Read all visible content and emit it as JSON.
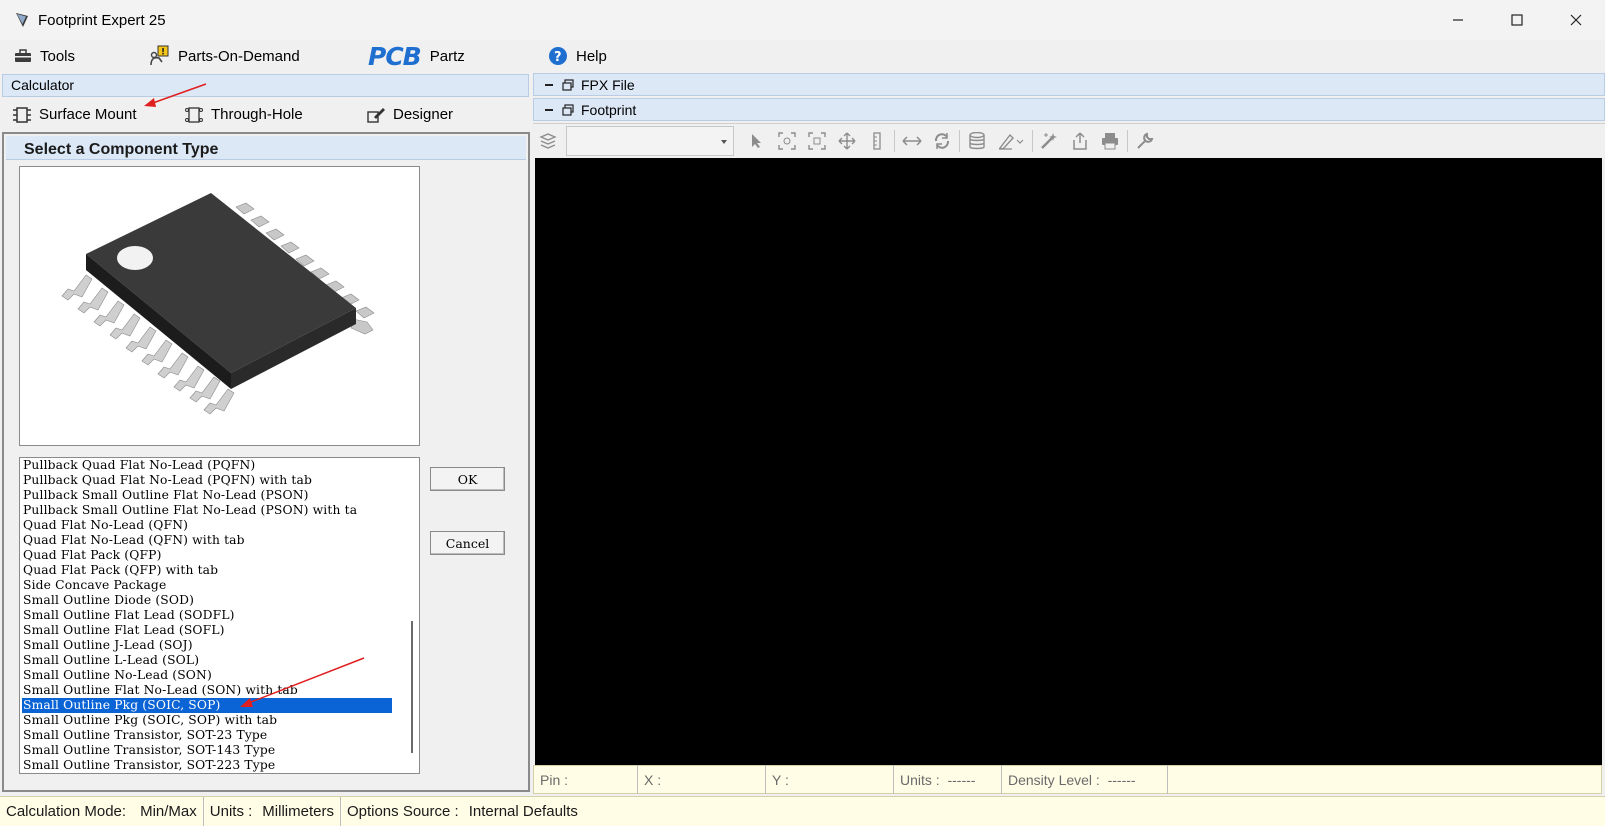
{
  "window": {
    "title": "Footprint Expert 25"
  },
  "menu": {
    "tools": "Tools",
    "parts_on_demand": "Parts-On-Demand",
    "pcb_logo_text": "PCB",
    "partz": "Partz",
    "help": "Help"
  },
  "calculator": {
    "header": "Calculator",
    "tabs": {
      "surface_mount": "Surface Mount",
      "through_hole": "Through-Hole",
      "designer": "Designer"
    }
  },
  "component_select": {
    "header": "Select a Component Type",
    "items": [
      "Pullback Quad Flat No-Lead (PQFN)",
      "Pullback Quad Flat No-Lead (PQFN) with tab",
      "Pullback Small Outline Flat No-Lead (PSON)",
      "Pullback Small Outline Flat No-Lead (PSON) with ta",
      "Quad Flat No-Lead (QFN)",
      "Quad Flat No-Lead (QFN) with tab",
      "Quad Flat Pack (QFP)",
      "Quad Flat Pack (QFP) with tab",
      "Side Concave Package",
      "Small Outline Diode (SOD)",
      "Small Outline Flat Lead (SODFL)",
      "Small Outline Flat Lead (SOFL)",
      "Small Outline J-Lead (SOJ)",
      "Small Outline L-Lead (SOL)",
      "Small Outline No-Lead (SON)",
      "Small Outline Flat No-Lead (SON) with tab",
      "Small Outline Pkg (SOIC, SOP)",
      "Small Outline Pkg (SOIC, SOP) with tab",
      "Small Outline Transistor, SOT-23 Type",
      "Small Outline Transistor, SOT-143 Type",
      "Small Outline Transistor, SOT-223 Type"
    ],
    "selected_item": "Small Outline Pkg (SOIC, SOP)",
    "ok_label": "OK",
    "cancel_label": "Cancel"
  },
  "right_panel": {
    "fpx_file": "FPX File",
    "footprint": "Footprint",
    "layer_combo_value": ""
  },
  "footprint_status": {
    "pin": "Pin :",
    "x": "X :",
    "y": "Y :",
    "units": "Units :  ------",
    "density": "Density Level :  ------"
  },
  "bottom_status": {
    "calc_mode_label": "Calculation Mode:",
    "calc_mode_value": "Min/Max",
    "units_label": "Units :",
    "units_value": "Millimeters",
    "options_label": "Options Source :",
    "options_value": "Internal Defaults"
  },
  "colors": {
    "selection": "#0a64d6",
    "header_bg": "#dce8f6",
    "status_bg": "#fffde6",
    "canvas": "#000000",
    "pcb_logo": "#1f6fd1",
    "help_icon": "#1f6fd1",
    "annotation_arrow": "#e02020"
  }
}
